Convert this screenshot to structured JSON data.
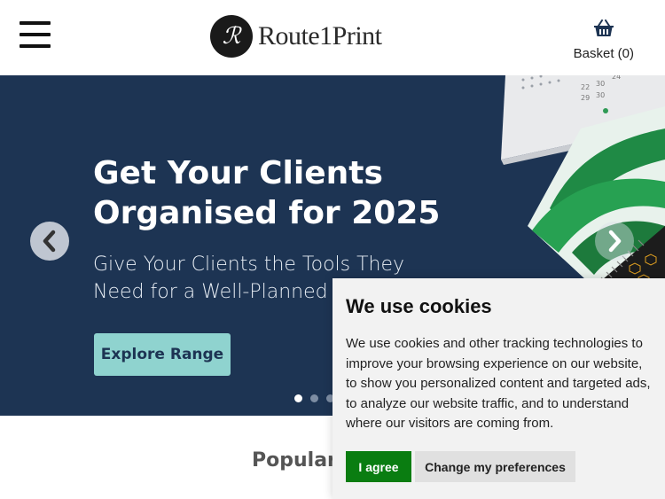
{
  "header": {
    "logo_mark": "ℛ",
    "logo_text": "Route1Print",
    "basket_label": "Basket (0)"
  },
  "hero": {
    "title": "Get Your Clients Organised for 2025",
    "subtitle": "Give Your Clients the Tools They Need for a Well-Planned Year",
    "cta_label": "Explore Range",
    "slides_count": 3,
    "active_slide": 1
  },
  "section": {
    "title": "Popular Products"
  },
  "cookie": {
    "title": "We use cookies",
    "body": "We use cookies and other tracking technologies to improve your browsing experience on our website, to show you personalized content and targeted ads, to analyze our website traffic, and to understand where our visitors are coming from.",
    "agree_label": "I agree",
    "prefs_label": "Change my preferences"
  },
  "colors": {
    "hero_bg": "#1d3453",
    "cta_bg": "#8fd3cf",
    "agree_bg": "#0a7d11"
  },
  "icons": [
    "menu-icon",
    "basket-icon",
    "chevron-left-icon",
    "chevron-right-icon"
  ]
}
